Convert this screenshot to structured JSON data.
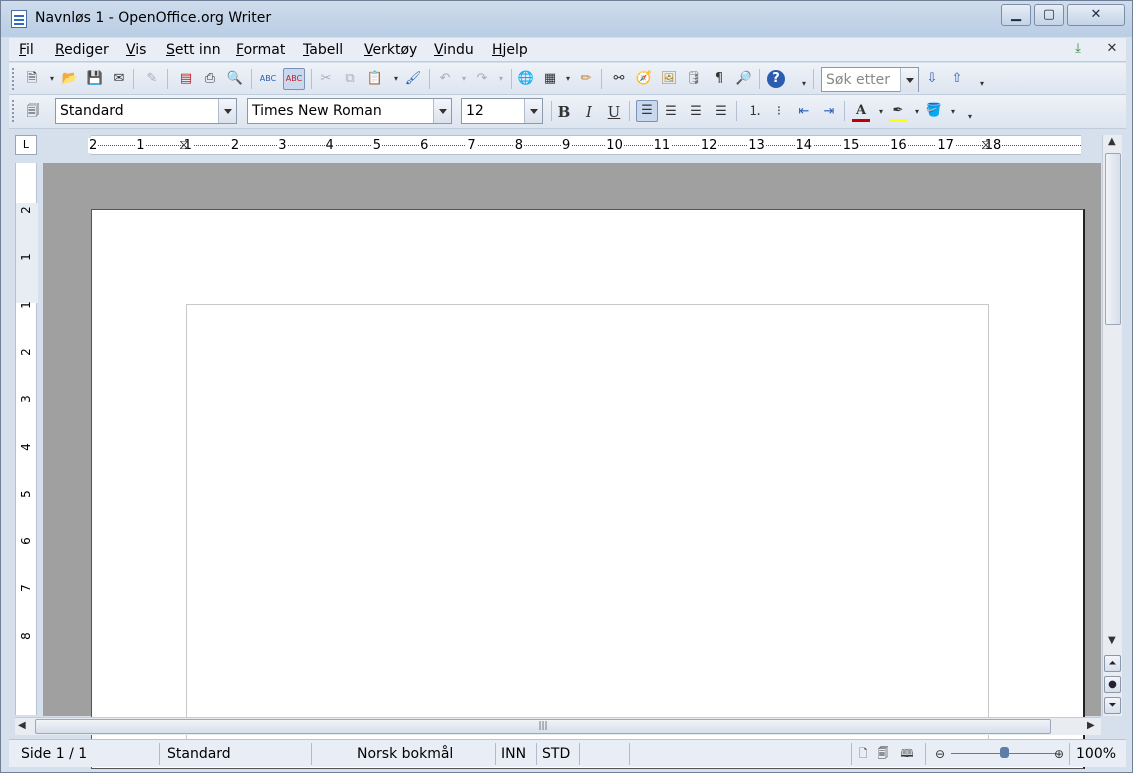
{
  "window": {
    "title": "Navnløs 1 - OpenOffice.org Writer",
    "min_glyph": "▁",
    "max_glyph": "▢",
    "close_glyph": "✕"
  },
  "menubar": {
    "items": [
      {
        "first": "F",
        "rest": "il"
      },
      {
        "first": "R",
        "rest": "ediger"
      },
      {
        "first": "V",
        "rest": "is"
      },
      {
        "first": "S",
        "rest": "ett inn"
      },
      {
        "first": "F",
        "rest": "ormat"
      },
      {
        "first": "T",
        "rest": "abell"
      },
      {
        "first": "V",
        "rest": "erktøy"
      },
      {
        "first": "V",
        "rest": "indu"
      },
      {
        "first": "H",
        "rest": "jelp"
      }
    ],
    "close_doc_glyph": "✕"
  },
  "standard_toolbar": {
    "search_placeholder": "Søk etter"
  },
  "format_toolbar": {
    "paragraph_style": "Standard",
    "font_name": "Times New Roman",
    "font_size": "12",
    "bold_label": "B",
    "italic_label": "I",
    "underline_label": "U",
    "font_color": "#c00000",
    "highlight_color": "#ffff00"
  },
  "ruler": {
    "corner_glyph": "L",
    "h_labels": [
      "2",
      "1",
      "1",
      "2",
      "3",
      "4",
      "5",
      "6",
      "7",
      "8",
      "9",
      "10",
      "11",
      "12",
      "13",
      "14",
      "15",
      "16",
      "17",
      "18"
    ],
    "v_labels": [
      "2",
      "1",
      "1",
      "2",
      "3",
      "4",
      "5",
      "6",
      "7",
      "8"
    ]
  },
  "statusbar": {
    "page": "Side 1 / 1",
    "style": "Standard",
    "language": "Norsk bokmål",
    "insert_mode": "INN",
    "selection_mode": "STD",
    "zoom_percent": "100%",
    "zoom_level": 100
  },
  "colors": {
    "accent": "#2f6cc4",
    "doc_background": "#a0a0a0"
  }
}
